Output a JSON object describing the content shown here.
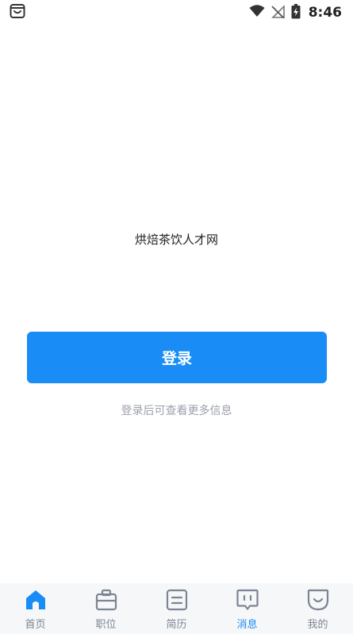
{
  "status_bar": {
    "time": "8:46",
    "icons": [
      "app-notification-icon",
      "wifi-icon",
      "no-signal-icon",
      "battery-charging-icon"
    ]
  },
  "main": {
    "app_name": "烘焙茶饮人才网",
    "login_button_label": "登录",
    "login_hint": "登录后可查看更多信息"
  },
  "tab_bar": {
    "active_tab": "消息",
    "tabs": [
      {
        "label": "首页",
        "icon": "home-icon"
      },
      {
        "label": "职位",
        "icon": "briefcase-icon"
      },
      {
        "label": "简历",
        "icon": "resume-icon"
      },
      {
        "label": "消息",
        "icon": "message-icon"
      },
      {
        "label": "我的",
        "icon": "profile-icon"
      }
    ]
  },
  "colors": {
    "accent": "#1a8cf5",
    "tab_inactive": "#7d8593",
    "hint_text": "#9aa0ab"
  }
}
